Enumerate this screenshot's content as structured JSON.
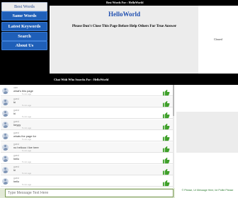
{
  "nav": {
    "items": [
      {
        "label": "Best Words",
        "style": "active"
      },
      {
        "label": "Same Words",
        "style": "blue"
      },
      {
        "label": "Latest Keywords",
        "style": "blue"
      },
      {
        "label": "Search",
        "style": "blue"
      },
      {
        "label": "About Us",
        "style": "blue"
      }
    ]
  },
  "header": {
    "top_text": "Best Words For : HelloWorld",
    "brand": "HelloWorld",
    "notice": "Please Don't Close This Page Before Help Others For True Answer"
  },
  "right_box": {
    "label": "Cleared"
  },
  "chat": {
    "heading": "Chat With Who Searchs For : HelloWorld",
    "messages": [
      {
        "user": "user",
        "text": "what's this page",
        "time": "5 min ago"
      },
      {
        "user": "guest",
        "text": "hi",
        "time": "5 min ago"
      },
      {
        "user": "guest",
        "text": "hi",
        "time": "5 min ago"
      },
      {
        "user": "guest",
        "text": "heyyy",
        "time": "5 min ago"
      },
      {
        "user": "guest",
        "text": "whats the page for",
        "time": "5 min ago"
      },
      {
        "user": "guest",
        "text": "no hellooo i live here",
        "time": "5 min ago"
      },
      {
        "user": "guest",
        "text": "hello",
        "time": "5 min ago"
      },
      {
        "user": "guest",
        "text": "hi",
        "time": "5 min ago"
      },
      {
        "user": "guest",
        "text": "hello",
        "time": "5 min ago"
      }
    ]
  },
  "input": {
    "placeholder": "Type Message Text Here"
  },
  "side_note": "© Please, Ur Message Here, be Polite Please",
  "colors": {
    "nav_blue": "#1f5fb8",
    "brand_blue": "#1f4fb0",
    "like_green": "#3fa02a"
  },
  "icons": {
    "avatar": "user-avatar-icon",
    "like": "thumbs-up-icon"
  }
}
